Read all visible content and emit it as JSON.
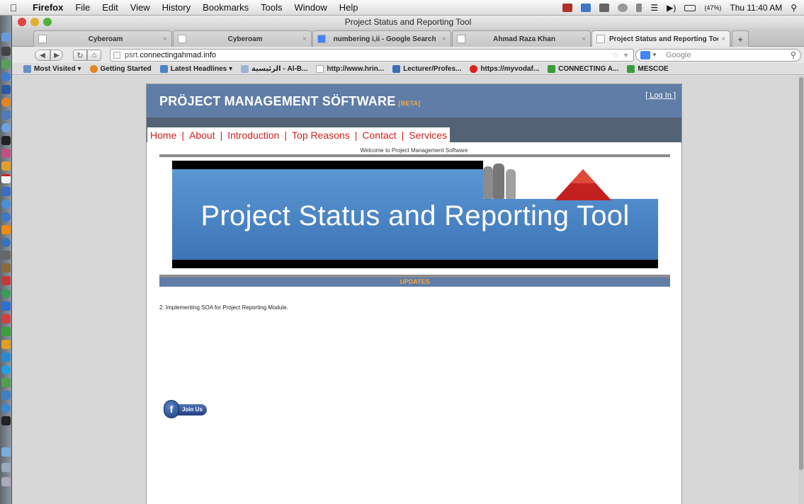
{
  "menubar": {
    "app": "Firefox",
    "items": [
      "File",
      "Edit",
      "View",
      "History",
      "Bookmarks",
      "Tools",
      "Window",
      "Help"
    ],
    "battery": "(47%)",
    "clock": "Thu 11:40 AM"
  },
  "window": {
    "title": "Project Status and Reporting Tool"
  },
  "tabs": [
    {
      "title": "Cyberoam",
      "active": false
    },
    {
      "title": "Cyberoam",
      "active": false
    },
    {
      "title": "numbering i,ii - Google Search",
      "active": false
    },
    {
      "title": "Ahmad Raza Khan",
      "active": false
    },
    {
      "title": "Project Status and Reporting Tool",
      "active": true
    }
  ],
  "tab_close_glyph": "×",
  "new_tab_glyph": "+",
  "navbar": {
    "url_prefix": "psrt.",
    "url_domain": "connectingahmad.info",
    "search_placeholder": "Google"
  },
  "bookmarks": [
    {
      "label": "Most Visited ▾",
      "color": "#6a8fc7"
    },
    {
      "label": "Getting Started",
      "color": "#e8841f"
    },
    {
      "label": "Latest Headlines ▾",
      "color": "#4a82c5"
    },
    {
      "label": "الرئيسية - Al-B...",
      "color": "#9db3d8"
    },
    {
      "label": "http://www.hrin...",
      "color": "#ffffff"
    },
    {
      "label": "Lecturer/Profes...",
      "color": "#3b6fb8"
    },
    {
      "label": "https://myvodaf...",
      "color": "#e02020"
    },
    {
      "label": "CONNECTING A...",
      "color": "#3d9b3d"
    },
    {
      "label": "MESCOE",
      "color": "#3d9b3d"
    }
  ],
  "site": {
    "title": "PRÖJECT MANAGEMENT SÖFTWARE",
    "beta": "[BETA]",
    "login": "[ Log In ]",
    "nav": [
      "Home",
      "About",
      "Introduction",
      "Top Reasons",
      "Contact",
      "Services"
    ],
    "nav_separator": "|",
    "welcome": "Welcome to Project Management Software",
    "banner_title": "Project Status and Reporting Tool",
    "updates_heading": "UPDATES",
    "update_item": "2. Implementing SOA for Project Reporting Module.",
    "join_us": "Join Us"
  },
  "colors": {
    "header_blue": "#5f7da7",
    "nav_strip": "#536274",
    "nav_link_red": "#d1201b",
    "accent_orange": "#f2a94a",
    "banner_blue": "#4a85c6"
  }
}
